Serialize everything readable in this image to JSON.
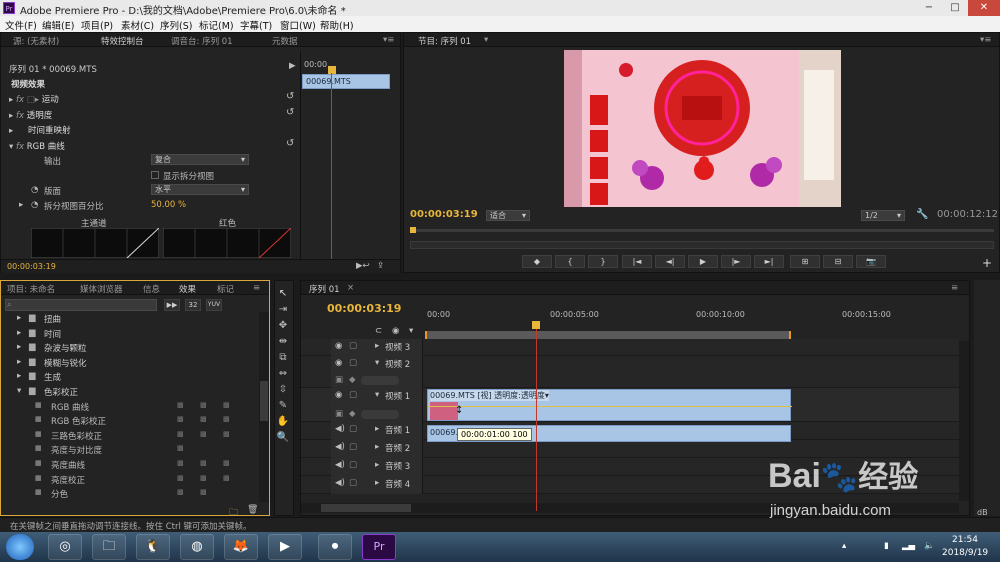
{
  "window": {
    "title": "Adobe Premiere Pro - D:\\我的文档\\Adobe\\Premiere Pro\\6.0\\未命名 *",
    "app_icon": "Pr"
  },
  "window_controls": {
    "minimize": "−",
    "maximize": "□",
    "close": "✕"
  },
  "menu": [
    "文件(F)",
    "编辑(E)",
    "项目(P)",
    "素材(C)",
    "序列(S)",
    "标记(M)",
    "字幕(T)",
    "窗口(W)",
    "帮助(H)"
  ],
  "source_panel": {
    "tabs": [
      "源: (无素材)",
      "特效控制台",
      "调音台: 序列 01",
      "元数据"
    ],
    "clip_path": "序列 01 * 00069.MTS",
    "timecode_top": "00:00",
    "clip_bar": "00069.MTS",
    "section": "视频效果",
    "effects": [
      {
        "fx": "fx",
        "name": "运动"
      },
      {
        "fx": "fx",
        "name": "透明度"
      },
      {
        "fx": "",
        "name": "时间重映射"
      },
      {
        "fx": "fx",
        "name": "RGB 曲线"
      }
    ],
    "output_label": "输出",
    "output_value": "复合",
    "split_label": "显示拆分视图",
    "layout_label": "版面",
    "layout_value": "水平",
    "split_pct_label": "拆分视图百分比",
    "split_pct_value": "50.00 %",
    "curve_labels": [
      "主通道",
      "红色"
    ],
    "timecode": "00:00:03:19"
  },
  "program_panel": {
    "tab": "节目: 序列 01",
    "timecode": "00:00:03:19",
    "fit": "适合",
    "res": "1/2",
    "duration": "00:00:12:12",
    "buttons": [
      "◆",
      "{",
      "}",
      "|◄",
      "◄|",
      "▶",
      "|►",
      "►|",
      "⊞",
      "⊟",
      "📷"
    ],
    "plus": "+"
  },
  "project_panel": {
    "tabs": [
      "项目: 未命名",
      "媒体浏览器",
      "信息",
      "效果",
      "标记"
    ],
    "toolbar": [
      "32",
      "32",
      "YUV"
    ],
    "tree": [
      {
        "name": "扭曲",
        "depth": 1,
        "type": "folder"
      },
      {
        "name": "时间",
        "depth": 1,
        "type": "folder"
      },
      {
        "name": "杂波与颗粒",
        "depth": 1,
        "type": "folder"
      },
      {
        "name": "模糊与锐化",
        "depth": 1,
        "type": "folder"
      },
      {
        "name": "生成",
        "depth": 1,
        "type": "folder"
      },
      {
        "name": "色彩校正",
        "depth": 1,
        "type": "folder-open"
      },
      {
        "name": "RGB 曲线",
        "depth": 2,
        "type": "fx"
      },
      {
        "name": "RGB 色彩校正",
        "depth": 2,
        "type": "fx"
      },
      {
        "name": "三路色彩校正",
        "depth": 2,
        "type": "fx"
      },
      {
        "name": "亮度与对比度",
        "depth": 2,
        "type": "fx"
      },
      {
        "name": "亮度曲线",
        "depth": 2,
        "type": "fx"
      },
      {
        "name": "亮度校正",
        "depth": 2,
        "type": "fx"
      },
      {
        "name": "分色",
        "depth": 2,
        "type": "fx"
      }
    ]
  },
  "tools": [
    "↖",
    "⇥",
    "✥",
    "⇹",
    "⧉",
    "⇔",
    "⇳",
    "✎",
    "✋",
    "🔍"
  ],
  "timeline": {
    "tab": "序列 01",
    "timecode": "00:00:03:19",
    "ruler": [
      "00:00",
      "00:00:05:00",
      "00:00:10:00",
      "00:00:15:00"
    ],
    "tracks": [
      {
        "name": "视频 3",
        "type": "video"
      },
      {
        "name": "视频 2",
        "type": "video"
      },
      {
        "name": "视频 1",
        "type": "video"
      },
      {
        "name": "音频 1",
        "type": "audio"
      },
      {
        "name": "音频 2",
        "type": "audio"
      },
      {
        "name": "音频 3",
        "type": "audio"
      },
      {
        "name": "音频 4",
        "type": "audio"
      }
    ],
    "video_clip": "00069.MTS [视] 透明度:透明度▾",
    "audio_clip": "00069.M",
    "tooltip": "00:00:01:00  100"
  },
  "status": "在关键帧之间垂直拖动调节连接线。按住 Ctrl 键可添加关键帧。",
  "watermark": {
    "logo": "Bai度经验",
    "url": "jingyan.baidu.com"
  },
  "taskbar": {
    "time": "21:54",
    "date": "2018/9/19"
  }
}
